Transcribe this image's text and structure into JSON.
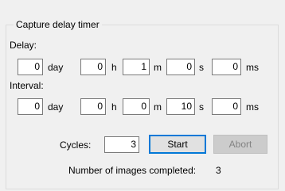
{
  "group": {
    "title": "Capture delay timer"
  },
  "delay": {
    "label": "Delay:",
    "day": {
      "value": "0",
      "unit": "day"
    },
    "hour": {
      "value": "0",
      "unit": "h"
    },
    "minute": {
      "value": "1",
      "unit": "m"
    },
    "second": {
      "value": "0",
      "unit": "s"
    },
    "millisecond": {
      "value": "0",
      "unit": "ms"
    }
  },
  "interval": {
    "label": "Interval:",
    "day": {
      "value": "0",
      "unit": "day"
    },
    "hour": {
      "value": "0",
      "unit": "h"
    },
    "minute": {
      "value": "0",
      "unit": "m"
    },
    "second": {
      "value": "10",
      "unit": "s"
    },
    "millisecond": {
      "value": "0",
      "unit": "ms"
    }
  },
  "cycles": {
    "label": "Cycles:",
    "value": "3"
  },
  "buttons": {
    "start": "Start",
    "abort": "Abort"
  },
  "status": {
    "label": "Number of images completed:",
    "count": "3"
  },
  "colors": {
    "accent": "#0078d7",
    "background": "#f0f0f0"
  }
}
